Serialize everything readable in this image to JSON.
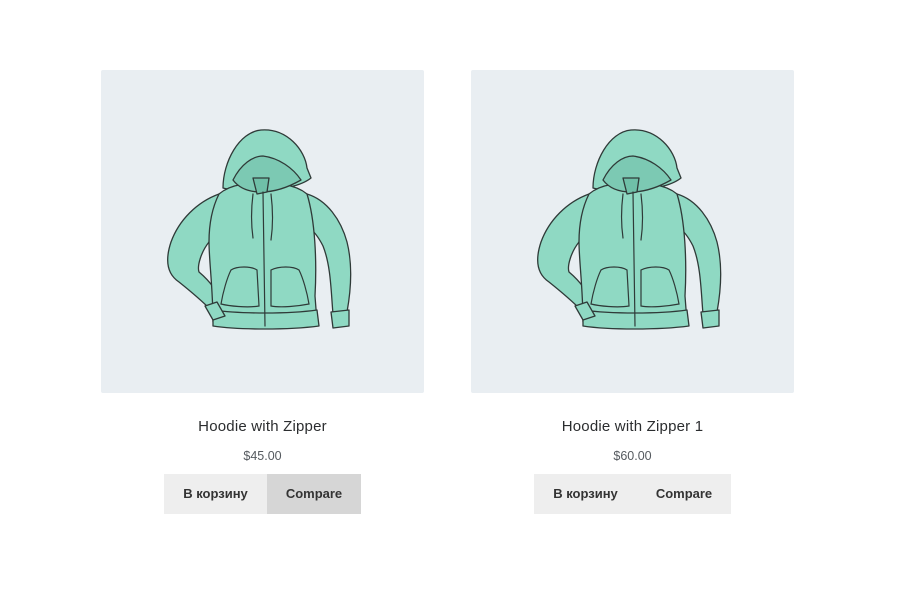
{
  "products": [
    {
      "title": "Hoodie with Zipper",
      "price": "$45.00",
      "cart_label": "В корзину",
      "compare_label": "Compare",
      "compare_active": true
    },
    {
      "title": "Hoodie with Zipper 1",
      "price": "$60.00",
      "cart_label": "В корзину",
      "compare_label": "Compare",
      "compare_active": false
    }
  ],
  "colors": {
    "thumb_bg": "#e9eef2",
    "hoodie_fill": "#8fd9c3",
    "hoodie_shade": "#7cc9b3",
    "outline": "#2f3a38",
    "button_bg": "#eeeeee",
    "button_active_bg": "#d6d6d6"
  }
}
